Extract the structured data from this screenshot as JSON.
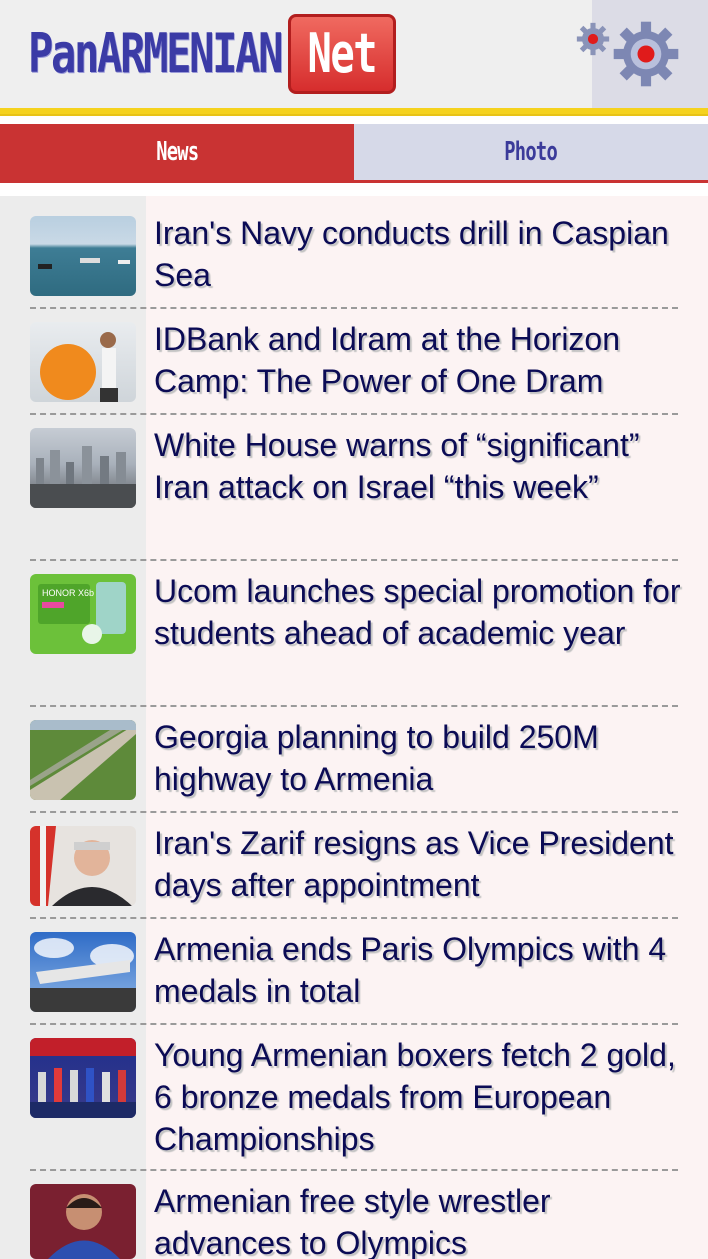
{
  "header": {
    "logo_main": "PanARMENIAN",
    "logo_net": "Net",
    "settings_icon": "gear-icon"
  },
  "tabs": [
    {
      "label": "News",
      "active": true
    },
    {
      "label": "Photo",
      "active": false
    }
  ],
  "colors": {
    "brand_blue": "#3b3ba6",
    "brand_red": "#c93333",
    "accent_yellow": "#f5d21e",
    "title_text": "#0b0b55"
  },
  "news": [
    {
      "title": "Iran's Navy conducts drill in Caspian Sea"
    },
    {
      "title": "IDBank and Idram at the Horizon Camp: The Power of One Dram"
    },
    {
      "title": "White House warns of “significant” Iran attack on Israel “this week”"
    },
    {
      "title": "Ucom launches special promotion for students ahead of academic year"
    },
    {
      "title": "Georgia planning to build 250M highway to Armenia"
    },
    {
      "title": "Iran's Zarif resigns as Vice President days after appointment"
    },
    {
      "title": "Armenia ends Paris Olympics with 4 medals in total"
    },
    {
      "title": "Young Armenian boxers fetch 2 gold, 6 bronze medals from European Championships"
    },
    {
      "title": "Armenian free style wrestler advances to Olympics"
    }
  ]
}
